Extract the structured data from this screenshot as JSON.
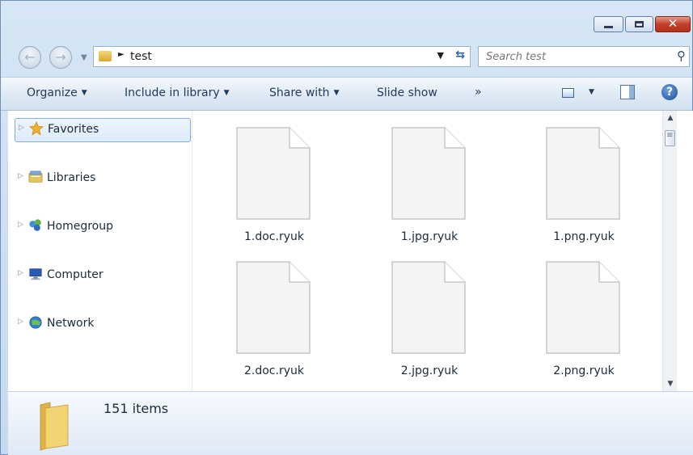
{
  "window": {
    "controls": {
      "minimize_icon": "minimize-icon",
      "maximize_icon": "maximize-icon",
      "close_icon": "close-icon"
    }
  },
  "address_bar": {
    "path_segments": [
      "test"
    ],
    "refresh_icon": "refresh-icon",
    "search_placeholder": "Search test"
  },
  "command_bar": {
    "organize": "Organize",
    "include_in_library": "Include in library",
    "share_with": "Share with",
    "slide_show": "Slide show",
    "more": "»"
  },
  "sidebar": {
    "items": [
      {
        "label": "Favorites",
        "icon": "star-icon",
        "selected": true
      },
      {
        "label": "Libraries",
        "icon": "libraries-icon",
        "selected": false
      },
      {
        "label": "Homegroup",
        "icon": "homegroup-icon",
        "selected": false
      },
      {
        "label": "Computer",
        "icon": "computer-icon",
        "selected": false
      },
      {
        "label": "Network",
        "icon": "network-icon",
        "selected": false
      }
    ]
  },
  "files": [
    {
      "name": "1.doc.ryuk"
    },
    {
      "name": "1.jpg.ryuk"
    },
    {
      "name": "1.png.ryuk"
    },
    {
      "name": "2.doc.ryuk"
    },
    {
      "name": "2.jpg.ryuk"
    },
    {
      "name": "2.png.ryuk"
    }
  ],
  "details": {
    "count_text": "151 items"
  },
  "colors": {
    "accent": "#1e395b",
    "title_bg": "#c5daee",
    "close_red": "#c2402a"
  }
}
